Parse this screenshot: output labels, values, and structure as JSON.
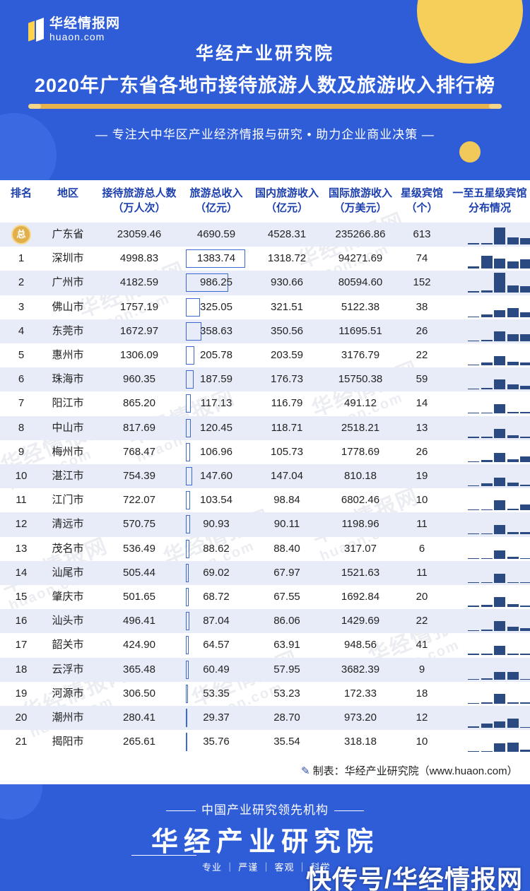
{
  "header": {
    "logo_cn": "华经情报网",
    "logo_en": "huaon.com",
    "org": "华经产业研究院",
    "title": "2020年广东省各地市接待旅游人数及旅游收入排行榜",
    "tagline": "— 专注大中华区产业经济情报与研究 • 助力企业商业决策 —"
  },
  "columns": {
    "rank": "排名",
    "region": "地区",
    "visitors_1": "接待旅游总人数",
    "visitors_2": "（万人次）",
    "income_1": "旅游总收入",
    "income_2": "（亿元）",
    "domestic_1": "国内旅游收入",
    "domestic_2": "（亿元）",
    "intl_1": "国际旅游收入",
    "intl_2": "（万美元）",
    "hotels_1": "星级宾馆",
    "hotels_2": "（个）",
    "dist_1": "一至五星级宾馆",
    "dist_2": "分布情况"
  },
  "total_badge": "总",
  "rows": [
    {
      "rank": "",
      "region": "广东省",
      "visitors": "23059.46",
      "income": "4690.59",
      "domestic": "4528.31",
      "intl": "235266.86",
      "hotels": "613",
      "dist": [
        2,
        4,
        48,
        20,
        18
      ]
    },
    {
      "rank": "1",
      "region": "深圳市",
      "visitors": "4998.83",
      "income": "1383.74",
      "domestic": "1318.72",
      "intl": "94271.69",
      "hotels": "74",
      "dist": [
        6,
        35,
        28,
        20,
        26
      ]
    },
    {
      "rank": "2",
      "region": "广州市",
      "visitors": "4182.59",
      "income": "986.25",
      "domestic": "930.66",
      "intl": "80594.60",
      "hotels": "152",
      "dist": [
        2,
        5,
        55,
        20,
        18
      ]
    },
    {
      "rank": "3",
      "region": "佛山市",
      "visitors": "1757.19",
      "income": "325.05",
      "domestic": "321.51",
      "intl": "5122.38",
      "hotels": "38",
      "dist": [
        0,
        8,
        20,
        25,
        14
      ]
    },
    {
      "rank": "4",
      "region": "东莞市",
      "visitors": "1672.97",
      "income": "358.63",
      "domestic": "350.56",
      "intl": "11695.51",
      "hotels": "26",
      "dist": [
        0,
        3,
        28,
        20,
        20
      ]
    },
    {
      "rank": "5",
      "region": "惠州市",
      "visitors": "1306.09",
      "income": "205.78",
      "domestic": "203.59",
      "intl": "3176.79",
      "hotels": "22",
      "dist": [
        0,
        8,
        25,
        10,
        8
      ]
    },
    {
      "rank": "6",
      "region": "珠海市",
      "visitors": "960.35",
      "income": "187.59",
      "domestic": "176.73",
      "intl": "15750.38",
      "hotels": "59",
      "dist": [
        0,
        4,
        27,
        14,
        10
      ]
    },
    {
      "rank": "7",
      "region": "阳江市",
      "visitors": "865.20",
      "income": "117.13",
      "domestic": "116.79",
      "intl": "491.12",
      "hotels": "14",
      "dist": [
        0,
        0,
        26,
        3,
        3
      ]
    },
    {
      "rank": "8",
      "region": "中山市",
      "visitors": "817.69",
      "income": "120.45",
      "domestic": "118.71",
      "intl": "2518.21",
      "hotels": "13",
      "dist": [
        1,
        1,
        25,
        8,
        3
      ]
    },
    {
      "rank": "9",
      "region": "梅州市",
      "visitors": "768.47",
      "income": "106.96",
      "domestic": "105.73",
      "intl": "1778.69",
      "hotels": "26",
      "dist": [
        0,
        6,
        26,
        8,
        15
      ]
    },
    {
      "rank": "10",
      "region": "湛江市",
      "visitors": "754.39",
      "income": "147.60",
      "domestic": "147.04",
      "intl": "810.18",
      "hotels": "19",
      "dist": [
        0,
        8,
        24,
        10,
        3
      ]
    },
    {
      "rank": "11",
      "region": "江门市",
      "visitors": "722.07",
      "income": "103.54",
      "domestic": "98.84",
      "intl": "6802.46",
      "hotels": "10",
      "dist": [
        0,
        0,
        28,
        4,
        16
      ]
    },
    {
      "rank": "12",
      "region": "清远市",
      "visitors": "570.75",
      "income": "90.93",
      "domestic": "90.11",
      "intl": "1198.96",
      "hotels": "11",
      "dist": [
        0,
        0,
        26,
        6,
        6
      ]
    },
    {
      "rank": "13",
      "region": "茂名市",
      "visitors": "536.49",
      "income": "88.62",
      "domestic": "88.40",
      "intl": "317.07",
      "hotels": "6",
      "dist": [
        0,
        0,
        24,
        5,
        0
      ]
    },
    {
      "rank": "14",
      "region": "汕尾市",
      "visitors": "505.44",
      "income": "69.02",
      "domestic": "67.97",
      "intl": "1521.63",
      "hotels": "11",
      "dist": [
        0,
        0,
        26,
        0,
        0
      ]
    },
    {
      "rank": "15",
      "region": "肇庆市",
      "visitors": "501.65",
      "income": "68.72",
      "domestic": "67.55",
      "intl": "1692.84",
      "hotels": "20",
      "dist": [
        1,
        6,
        27,
        7,
        3
      ]
    },
    {
      "rank": "16",
      "region": "汕头市",
      "visitors": "496.41",
      "income": "87.04",
      "domestic": "86.06",
      "intl": "1429.69",
      "hotels": "22",
      "dist": [
        0,
        4,
        28,
        12,
        7
      ]
    },
    {
      "rank": "17",
      "region": "韶关市",
      "visitors": "424.90",
      "income": "64.57",
      "domestic": "63.91",
      "intl": "948.56",
      "hotels": "41",
      "dist": [
        1,
        1,
        26,
        2,
        2
      ]
    },
    {
      "rank": "18",
      "region": "云浮市",
      "visitors": "365.48",
      "income": "60.49",
      "domestic": "57.95",
      "intl": "3682.39",
      "hotels": "9",
      "dist": [
        0,
        2,
        22,
        21,
        0
      ]
    },
    {
      "rank": "19",
      "region": "河源市",
      "visitors": "306.50",
      "income": "53.35",
      "domestic": "53.23",
      "intl": "172.33",
      "hotels": "18",
      "dist": [
        0,
        4,
        27,
        4,
        3
      ]
    },
    {
      "rank": "20",
      "region": "潮州市",
      "visitors": "280.41",
      "income": "29.37",
      "domestic": "28.70",
      "intl": "973.20",
      "hotels": "12",
      "dist": [
        1,
        11,
        17,
        26,
        0
      ]
    },
    {
      "rank": "21",
      "region": "揭阳市",
      "visitors": "265.61",
      "income": "35.76",
      "domestic": "35.54",
      "intl": "318.18",
      "hotels": "10",
      "dist": [
        0,
        0,
        24,
        26,
        5
      ]
    }
  ],
  "source": "制表：华经产业研究院（www.huaon.com）",
  "watermark": {
    "cn": "华经情报网",
    "en": "huaon.com"
  },
  "footer": {
    "subtitle": "中国产业研究领先机构",
    "title": "华经产业研究院",
    "tags": "专业 ｜ 严谨 ｜ 客观 ｜ 科学",
    "corner": "快传号/华经情报网"
  },
  "colors": {
    "primary": "#2f5dd8",
    "gold": "#e7b24c",
    "bar": "#2c4a82",
    "row_alt": "#e8ecf8"
  }
}
